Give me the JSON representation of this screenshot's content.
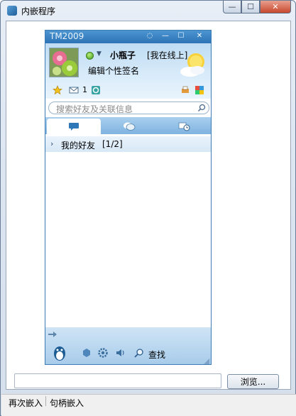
{
  "window": {
    "title": "内嵌程序",
    "min_glyph": "—",
    "max_glyph": "☐",
    "close_glyph": "✕"
  },
  "tm": {
    "title": "TM2009",
    "title_buttons": {
      "chat": "◌",
      "min": "—",
      "max": "☐",
      "close": "✕"
    },
    "user": {
      "nickname": "小瓶子",
      "status": "[我在线上]",
      "signature": "编辑个性签名",
      "mail_count": "1"
    },
    "search_placeholder": "搜索好友及关联信息",
    "tabs": [
      {
        "name": "contacts",
        "icon": "chat-bubble-icon"
      },
      {
        "name": "groups",
        "icon": "group-chat-icon"
      },
      {
        "name": "recent",
        "icon": "recent-clock-icon"
      }
    ],
    "friend_group": {
      "arrow": "›",
      "label": "我的好友",
      "count": "[1/2]"
    },
    "footer": {
      "find_label": "查找"
    }
  },
  "browse_label": "浏览...",
  "status_bar": {
    "left": "再次嵌入",
    "right": "句柄嵌入"
  },
  "colors": {
    "accent": "#2d73b6",
    "status_online": "#3f9a1b"
  }
}
